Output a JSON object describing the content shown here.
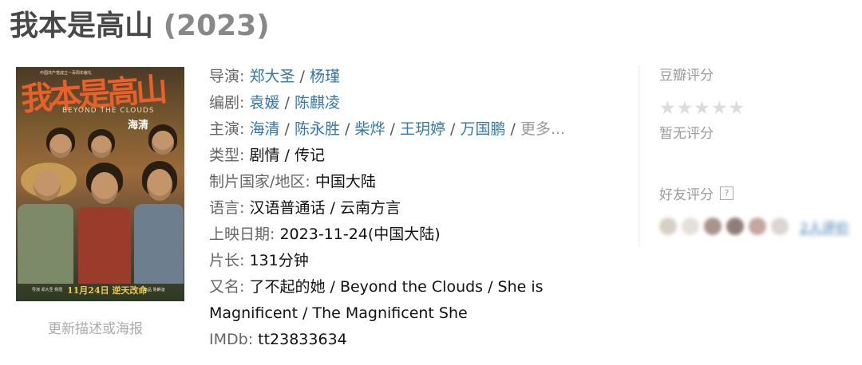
{
  "title": "我本是高山",
  "year": "(2023)",
  "poster": {
    "headline": "我本是高山",
    "subtitle": "BEYOND THE CLOUDS",
    "star": "海清",
    "tagline": "中国共产党成立一百周年献礼",
    "release": "11月24日 逆天改命",
    "credit_left": "导演 郑大圣 杨瑾",
    "credit_right": "出品 陈麒凌"
  },
  "update_link": "更新描述或海报",
  "info": {
    "director": {
      "label": "导演",
      "values": [
        "郑大圣",
        "杨瑾"
      ]
    },
    "writer": {
      "label": "编剧",
      "values": [
        "袁媛",
        "陈麒凌"
      ]
    },
    "cast": {
      "label": "主演",
      "values": [
        "海清",
        "陈永胜",
        "柴烨",
        "王玥婷",
        "万国鹏"
      ],
      "more": "更多..."
    },
    "genre": {
      "label": "类型",
      "value": "剧情 / 传记"
    },
    "region": {
      "label": "制片国家/地区",
      "value": "中国大陆"
    },
    "language": {
      "label": "语言",
      "value": "汉语普通话 / 云南方言"
    },
    "release_date": {
      "label": "上映日期",
      "value": "2023-11-24(中国大陆)"
    },
    "runtime": {
      "label": "片长",
      "value": "131分钟"
    },
    "aka": {
      "label": "又名",
      "value": "了不起的她 / Beyond the Clouds / She is Magnificent / The Magnificent She"
    },
    "imdb": {
      "label": "IMDb",
      "value": "tt23833634"
    }
  },
  "rating": {
    "label": "豆瓣评分",
    "stars": [
      "★",
      "★",
      "★",
      "★",
      "★"
    ],
    "no_rating": "暂无评分",
    "friends_label": "好友评分",
    "help_icon": "?",
    "friends_link": "2人评价"
  },
  "colors": {
    "link": "#3377aa",
    "title": "#494949",
    "muted": "#9b9b9b",
    "star_empty": "#dcdcdc"
  }
}
